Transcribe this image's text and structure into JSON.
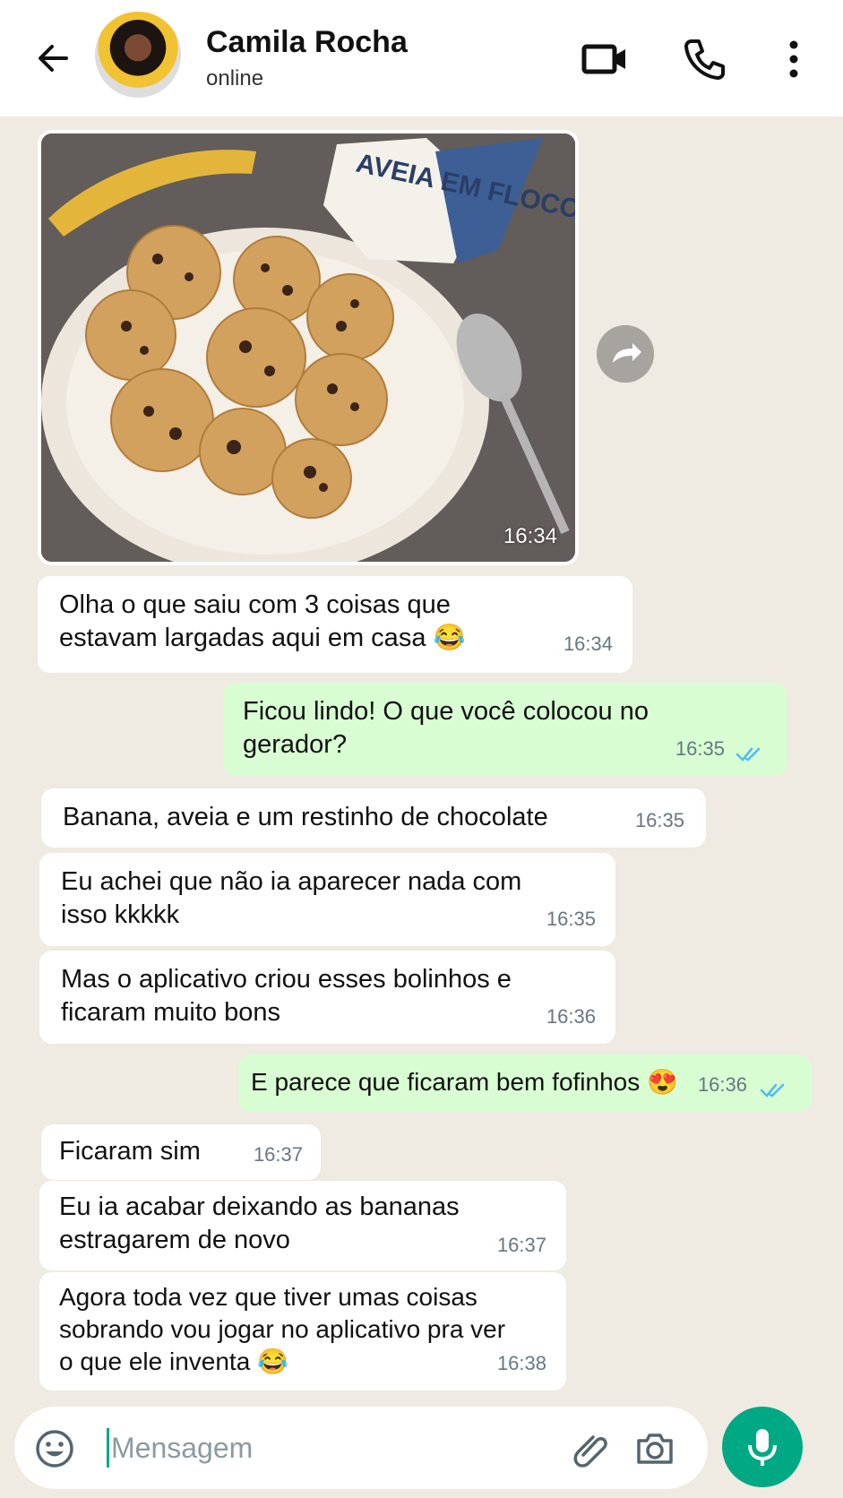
{
  "header": {
    "contact_name": "Camila Rocha",
    "status": "online",
    "icons": [
      "back-arrow-icon",
      "video-call-icon",
      "phone-call-icon",
      "more-options-icon"
    ]
  },
  "messages": [
    {
      "type": "image",
      "direction": "in",
      "time": "16:34",
      "caption": "",
      "image_content": "photo of muffins, banana, oat bag and spoon",
      "visible_packaging_text": "AVEIA EM FLOCOS"
    },
    {
      "type": "text",
      "direction": "in",
      "text": "Olha o que saiu com 3 coisas que\nestavam largadas aqui em casa 😂",
      "time": "16:34"
    },
    {
      "type": "text",
      "direction": "out",
      "text": "Ficou lindo! O que você colocou no\ngerador?",
      "time": "16:35",
      "read": true
    },
    {
      "type": "text",
      "direction": "in",
      "text": "Banana, aveia e um restinho de chocolate",
      "time": "16:35"
    },
    {
      "type": "text",
      "direction": "in",
      "text": "Eu achei que não ia aparecer nada com\nisso kkkkk",
      "time": "16:35"
    },
    {
      "type": "text",
      "direction": "in",
      "text": "Mas o aplicativo criou esses bolinhos e\nficaram muito bons",
      "time": "16:36"
    },
    {
      "type": "text",
      "direction": "out",
      "text": "E parece que ficaram bem fofinhos 😍",
      "time": "16:36",
      "read": true
    },
    {
      "type": "text",
      "direction": "in",
      "text": "Ficaram sim",
      "time": "16:37"
    },
    {
      "type": "text",
      "direction": "in",
      "text": "Eu ia acabar deixando as bananas\nestragarem de novo",
      "time": "16:37"
    },
    {
      "type": "text",
      "direction": "in",
      "text": "Agora toda vez que tiver umas coisas\nsobrando vou jogar no aplicativo pra ver\no que ele inventa 😂",
      "time": "16:38"
    }
  ],
  "composer": {
    "placeholder": "Mensagem",
    "icons": [
      "emoji-icon",
      "attach-icon",
      "camera-icon",
      "mic-icon"
    ]
  },
  "colors": {
    "accent": "#00a884",
    "chat_background": "#efeae2",
    "incoming_bubble": "#ffffff",
    "outgoing_bubble": "#d9fdd3",
    "read_ticks": "#53bdeb"
  }
}
